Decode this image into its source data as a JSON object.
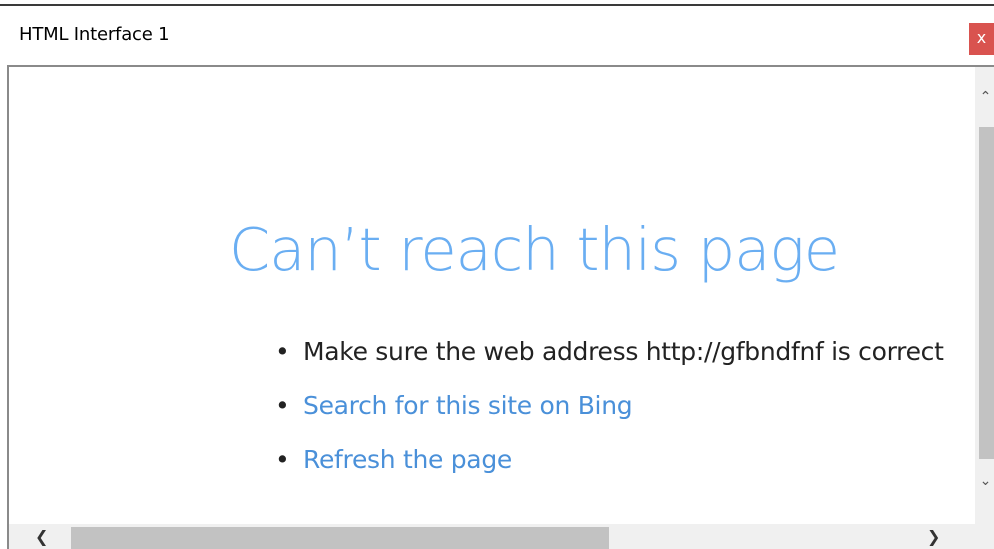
{
  "window": {
    "title": "HTML Interface 1",
    "close_label": "x"
  },
  "error_page": {
    "headline": "Can’t reach this page",
    "tips": [
      {
        "bullet": "•",
        "text": "Make sure the web address http://gfbndfnf is correct",
        "is_link": false
      },
      {
        "bullet": "•",
        "text": "Search for this site on Bing",
        "is_link": true
      },
      {
        "bullet": "•",
        "text": "Refresh the page",
        "is_link": true
      }
    ]
  },
  "scrollbars": {
    "up_icon": "chevron-up-icon",
    "down_icon": "chevron-down-icon",
    "left_icon": "chevron-left-icon",
    "right_icon": "chevron-right-icon",
    "up_glyph": "⌃",
    "down_glyph": "⌄",
    "left_glyph": "❮",
    "right_glyph": "❯"
  },
  "colors": {
    "headline": "#6aaef2",
    "link": "#4a90d9",
    "close_button": "#d9534f"
  }
}
